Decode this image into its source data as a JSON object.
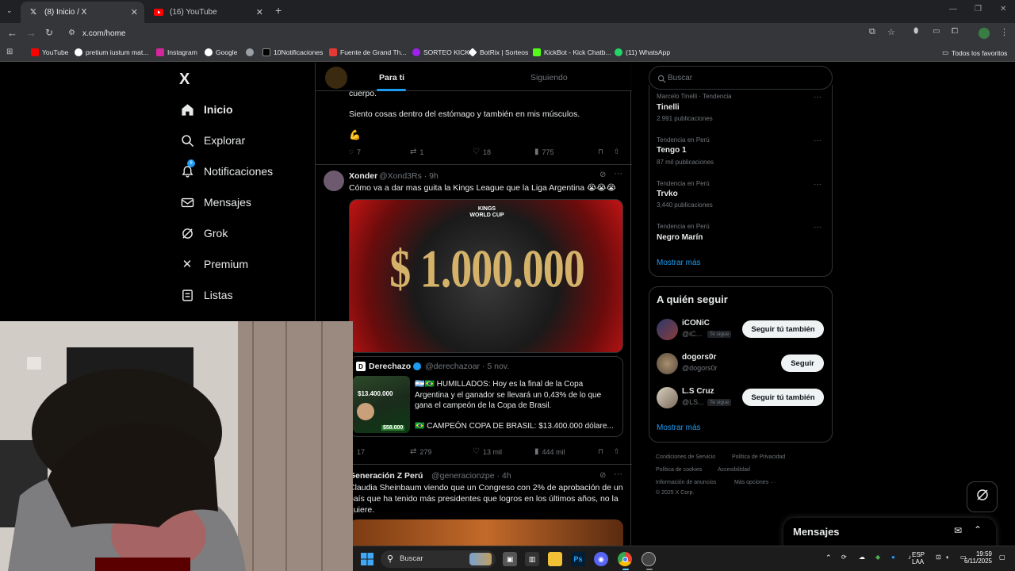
{
  "browser": {
    "tabs": [
      {
        "title": "(8) Inicio / X",
        "active": true
      },
      {
        "title": "(16) YouTube",
        "active": false
      }
    ],
    "new_tab": "+",
    "url": "x.com/home",
    "bookmarks": [
      {
        "label": "YouTube",
        "color": "#ff0000"
      },
      {
        "label": "pretium iustum mat...",
        "color": "#ffffff"
      },
      {
        "label": "Instagram",
        "color": "#d6249f"
      },
      {
        "label": "Google",
        "color": "#ffffff"
      },
      {
        "label": "",
        "color": "#9aa0a6"
      },
      {
        "label": "10Notificaciones",
        "color": "#000000"
      },
      {
        "label": "Fuente de Grand Th...",
        "color": "#e53935"
      },
      {
        "label": "SORTEO KICK",
        "color": "#a020f0"
      },
      {
        "label": "BotRix | Sorteos",
        "color": "#ffffff"
      },
      {
        "label": "KickBot - Kick Chatb...",
        "color": "#53fc18"
      },
      {
        "label": "(11) WhatsApp",
        "color": "#25d366"
      }
    ],
    "all_bookmarks": "Todos los favoritos"
  },
  "x": {
    "logo": "X",
    "nav": [
      {
        "label": "Inicio",
        "icon": "home-icon",
        "glyph": "⌂",
        "active": true
      },
      {
        "label": "Explorar",
        "icon": "search-icon",
        "glyph": "⚲",
        "active": false
      },
      {
        "label": "Notificaciones",
        "icon": "bell-icon",
        "glyph": "🔔",
        "active": false
      },
      {
        "label": "Mensajes",
        "icon": "mail-icon",
        "glyph": "✉",
        "active": false
      },
      {
        "label": "Grok",
        "icon": "grok-icon",
        "glyph": "⊘",
        "active": false
      },
      {
        "label": "Premium",
        "icon": "x-premium-icon",
        "glyph": "✕",
        "active": false
      },
      {
        "label": "Listas",
        "icon": "list-icon",
        "glyph": "☰",
        "active": false
      }
    ],
    "notif_badge": "8",
    "feed_tabs": {
      "for_you": "Para ti",
      "following": "Siguiendo"
    },
    "tweet1": {
      "text_cut": "cuerpo.",
      "text": "Siento cosas dentro del estómago y también en mis músculos.",
      "emoji": "💪",
      "replies": "7",
      "reposts": "1",
      "likes": "18",
      "views": "775"
    },
    "tweet2": {
      "name": "Xonder",
      "handle": "@Xond3Rs · 9h",
      "text": "Cómo va a dar mas guita la Kings League que la Liga Argentina 😭😭😭",
      "image_amount": "$ 1.000.000",
      "image_badge": "KINGS WORLD CUP",
      "quote_name": "Derechazo",
      "quote_handle": "@derechazoar · 5 nov.",
      "quote_line1": "🇦🇷🇧🇷 HUMILLADOS: Hoy es la final de la Copa",
      "quote_line2": "Argentina y el ganador se llevará un 0,43% de lo que",
      "quote_line3": "gana el campeón de la Copa de Brasil.",
      "quote_line4": "🇧🇷 CAMPEÓN COPA DE BRASIL: $13.400.000 dólare...",
      "quote_thumb_amount1": "$13.400.000",
      "quote_thumb_amount2": "$58.000",
      "replies": "17",
      "reposts": "279",
      "likes": "13 mil",
      "views": "444 mil"
    },
    "tweet3": {
      "name": "Generación Z Perú",
      "handle": "@generacionzpe · 4h",
      "line1": "Claudia Sheinbaum viendo que un Congreso con 2% de aprobación de un",
      "line2": "país que ha tenido más presidentes que logros en los últimos años, no la",
      "line3": "quiere."
    },
    "search_placeholder": "Buscar",
    "trends": [
      {
        "sub": "Marcelo Tinelli · Tendencia",
        "title": "Tinelli",
        "count": "2.991 publicaciones"
      },
      {
        "sub": "Tendencia en Perú",
        "title": "Tengo 1",
        "count": "87 mil publicaciones"
      },
      {
        "sub": "Tendencia en Perú",
        "title": "Trvko",
        "count": "3,440 publicaciones"
      },
      {
        "sub": "Tendencia en Perú",
        "title": "Negro Marín",
        "count": ""
      }
    ],
    "show_more": "Mostrar más",
    "who_to_follow": "A quién seguir",
    "follow": [
      {
        "name": "iCONiC",
        "handle": "@iC...",
        "tag": "Te sigue",
        "button": "Seguir tú también"
      },
      {
        "name": "dogors0r",
        "handle": "@dogors0r",
        "tag": "",
        "button": "Seguir"
      },
      {
        "name": "L.S Cruz",
        "handle": "@LS...",
        "tag": "Te sigue",
        "button": "Seguir tú también"
      }
    ],
    "show_more2": "Mostrar más",
    "footer": {
      "l1a": "Condiciones de Servicio",
      "l1b": "Política de Privacidad",
      "l2a": "Política de cookies",
      "l2b": "Accesibilidad",
      "l3a": "Información de anuncios",
      "l3b": "Más opciones ···",
      "copy": "© 2025 X Corp."
    },
    "messages_drawer": "Mensajes"
  },
  "taskbar": {
    "search": "Buscar",
    "lang1": "ESP",
    "lang2": "LAA",
    "time": "19:59",
    "date": "6/11/2025"
  }
}
